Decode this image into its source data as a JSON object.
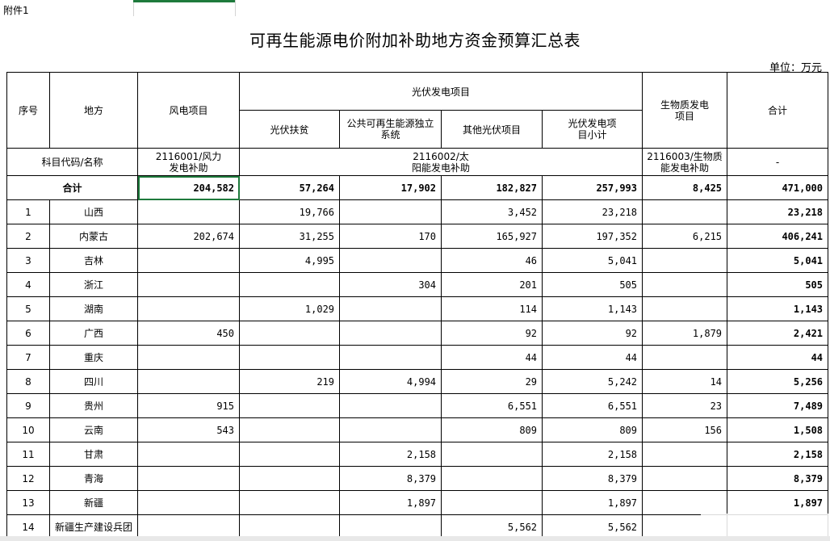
{
  "annex": "附件1",
  "title": "可再生能源电价附加补助地方资金预算汇总表",
  "unit": "单位：万元",
  "headers": {
    "seq": "序号",
    "region": "地方",
    "wind": "风电项目",
    "pv_group": "光伏发电项目",
    "pv_poverty": "光伏扶贫",
    "pv_public": "公共可再生能源独立系统",
    "pv_other": "其他光伏项目",
    "pv_subtotal": "光伏发电项目小计",
    "bio": "生物质发电项目",
    "total": "合计"
  },
  "codes": {
    "label": "科目代码/名称",
    "wind": "2116001/风力发电补助",
    "pv": "2116002/太阳能发电补助",
    "bio": "2116003/生物质能发电补助",
    "total": "-"
  },
  "sum_row": {
    "label": "合计",
    "wind": "204,582",
    "pv_poverty": "57,264",
    "pv_public": "17,902",
    "pv_other": "182,827",
    "pv_subtotal": "257,993",
    "bio": "8,425",
    "total": "471,000"
  },
  "rows": [
    {
      "seq": "1",
      "region": "山西",
      "wind": "",
      "pv_poverty": "19,766",
      "pv_public": "",
      "pv_other": "3,452",
      "pv_subtotal": "23,218",
      "bio": "",
      "total": "23,218"
    },
    {
      "seq": "2",
      "region": "内蒙古",
      "wind": "202,674",
      "pv_poverty": "31,255",
      "pv_public": "170",
      "pv_other": "165,927",
      "pv_subtotal": "197,352",
      "bio": "6,215",
      "total": "406,241"
    },
    {
      "seq": "3",
      "region": "吉林",
      "wind": "",
      "pv_poverty": "4,995",
      "pv_public": "",
      "pv_other": "46",
      "pv_subtotal": "5,041",
      "bio": "",
      "total": "5,041"
    },
    {
      "seq": "4",
      "region": "浙江",
      "wind": "",
      "pv_poverty": "",
      "pv_public": "304",
      "pv_other": "201",
      "pv_subtotal": "505",
      "bio": "",
      "total": "505"
    },
    {
      "seq": "5",
      "region": "湖南",
      "wind": "",
      "pv_poverty": "1,029",
      "pv_public": "",
      "pv_other": "114",
      "pv_subtotal": "1,143",
      "bio": "",
      "total": "1,143"
    },
    {
      "seq": "6",
      "region": "广西",
      "wind": "450",
      "pv_poverty": "",
      "pv_public": "",
      "pv_other": "92",
      "pv_subtotal": "92",
      "bio": "1,879",
      "total": "2,421"
    },
    {
      "seq": "7",
      "region": "重庆",
      "wind": "",
      "pv_poverty": "",
      "pv_public": "",
      "pv_other": "44",
      "pv_subtotal": "44",
      "bio": "",
      "total": "44"
    },
    {
      "seq": "8",
      "region": "四川",
      "wind": "",
      "pv_poverty": "219",
      "pv_public": "4,994",
      "pv_other": "29",
      "pv_subtotal": "5,242",
      "bio": "14",
      "total": "5,256"
    },
    {
      "seq": "9",
      "region": "贵州",
      "wind": "915",
      "pv_poverty": "",
      "pv_public": "",
      "pv_other": "6,551",
      "pv_subtotal": "6,551",
      "bio": "23",
      "total": "7,489"
    },
    {
      "seq": "10",
      "region": "云南",
      "wind": "543",
      "pv_poverty": "",
      "pv_public": "",
      "pv_other": "809",
      "pv_subtotal": "809",
      "bio": "156",
      "total": "1,508"
    },
    {
      "seq": "11",
      "region": "甘肃",
      "wind": "",
      "pv_poverty": "",
      "pv_public": "2,158",
      "pv_other": "",
      "pv_subtotal": "2,158",
      "bio": "",
      "total": "2,158"
    },
    {
      "seq": "12",
      "region": "青海",
      "wind": "",
      "pv_poverty": "",
      "pv_public": "8,379",
      "pv_other": "",
      "pv_subtotal": "8,379",
      "bio": "",
      "total": "8,379"
    },
    {
      "seq": "13",
      "region": "新疆",
      "wind": "",
      "pv_poverty": "",
      "pv_public": "1,897",
      "pv_other": "",
      "pv_subtotal": "1,897",
      "bio": "",
      "total": "1,897"
    },
    {
      "seq": "14",
      "region": "新疆生产建设兵团",
      "wind": "",
      "pv_poverty": "",
      "pv_public": "",
      "pv_other": "5,562",
      "pv_subtotal": "5,562",
      "bio": "",
      "total": ""
    }
  ]
}
